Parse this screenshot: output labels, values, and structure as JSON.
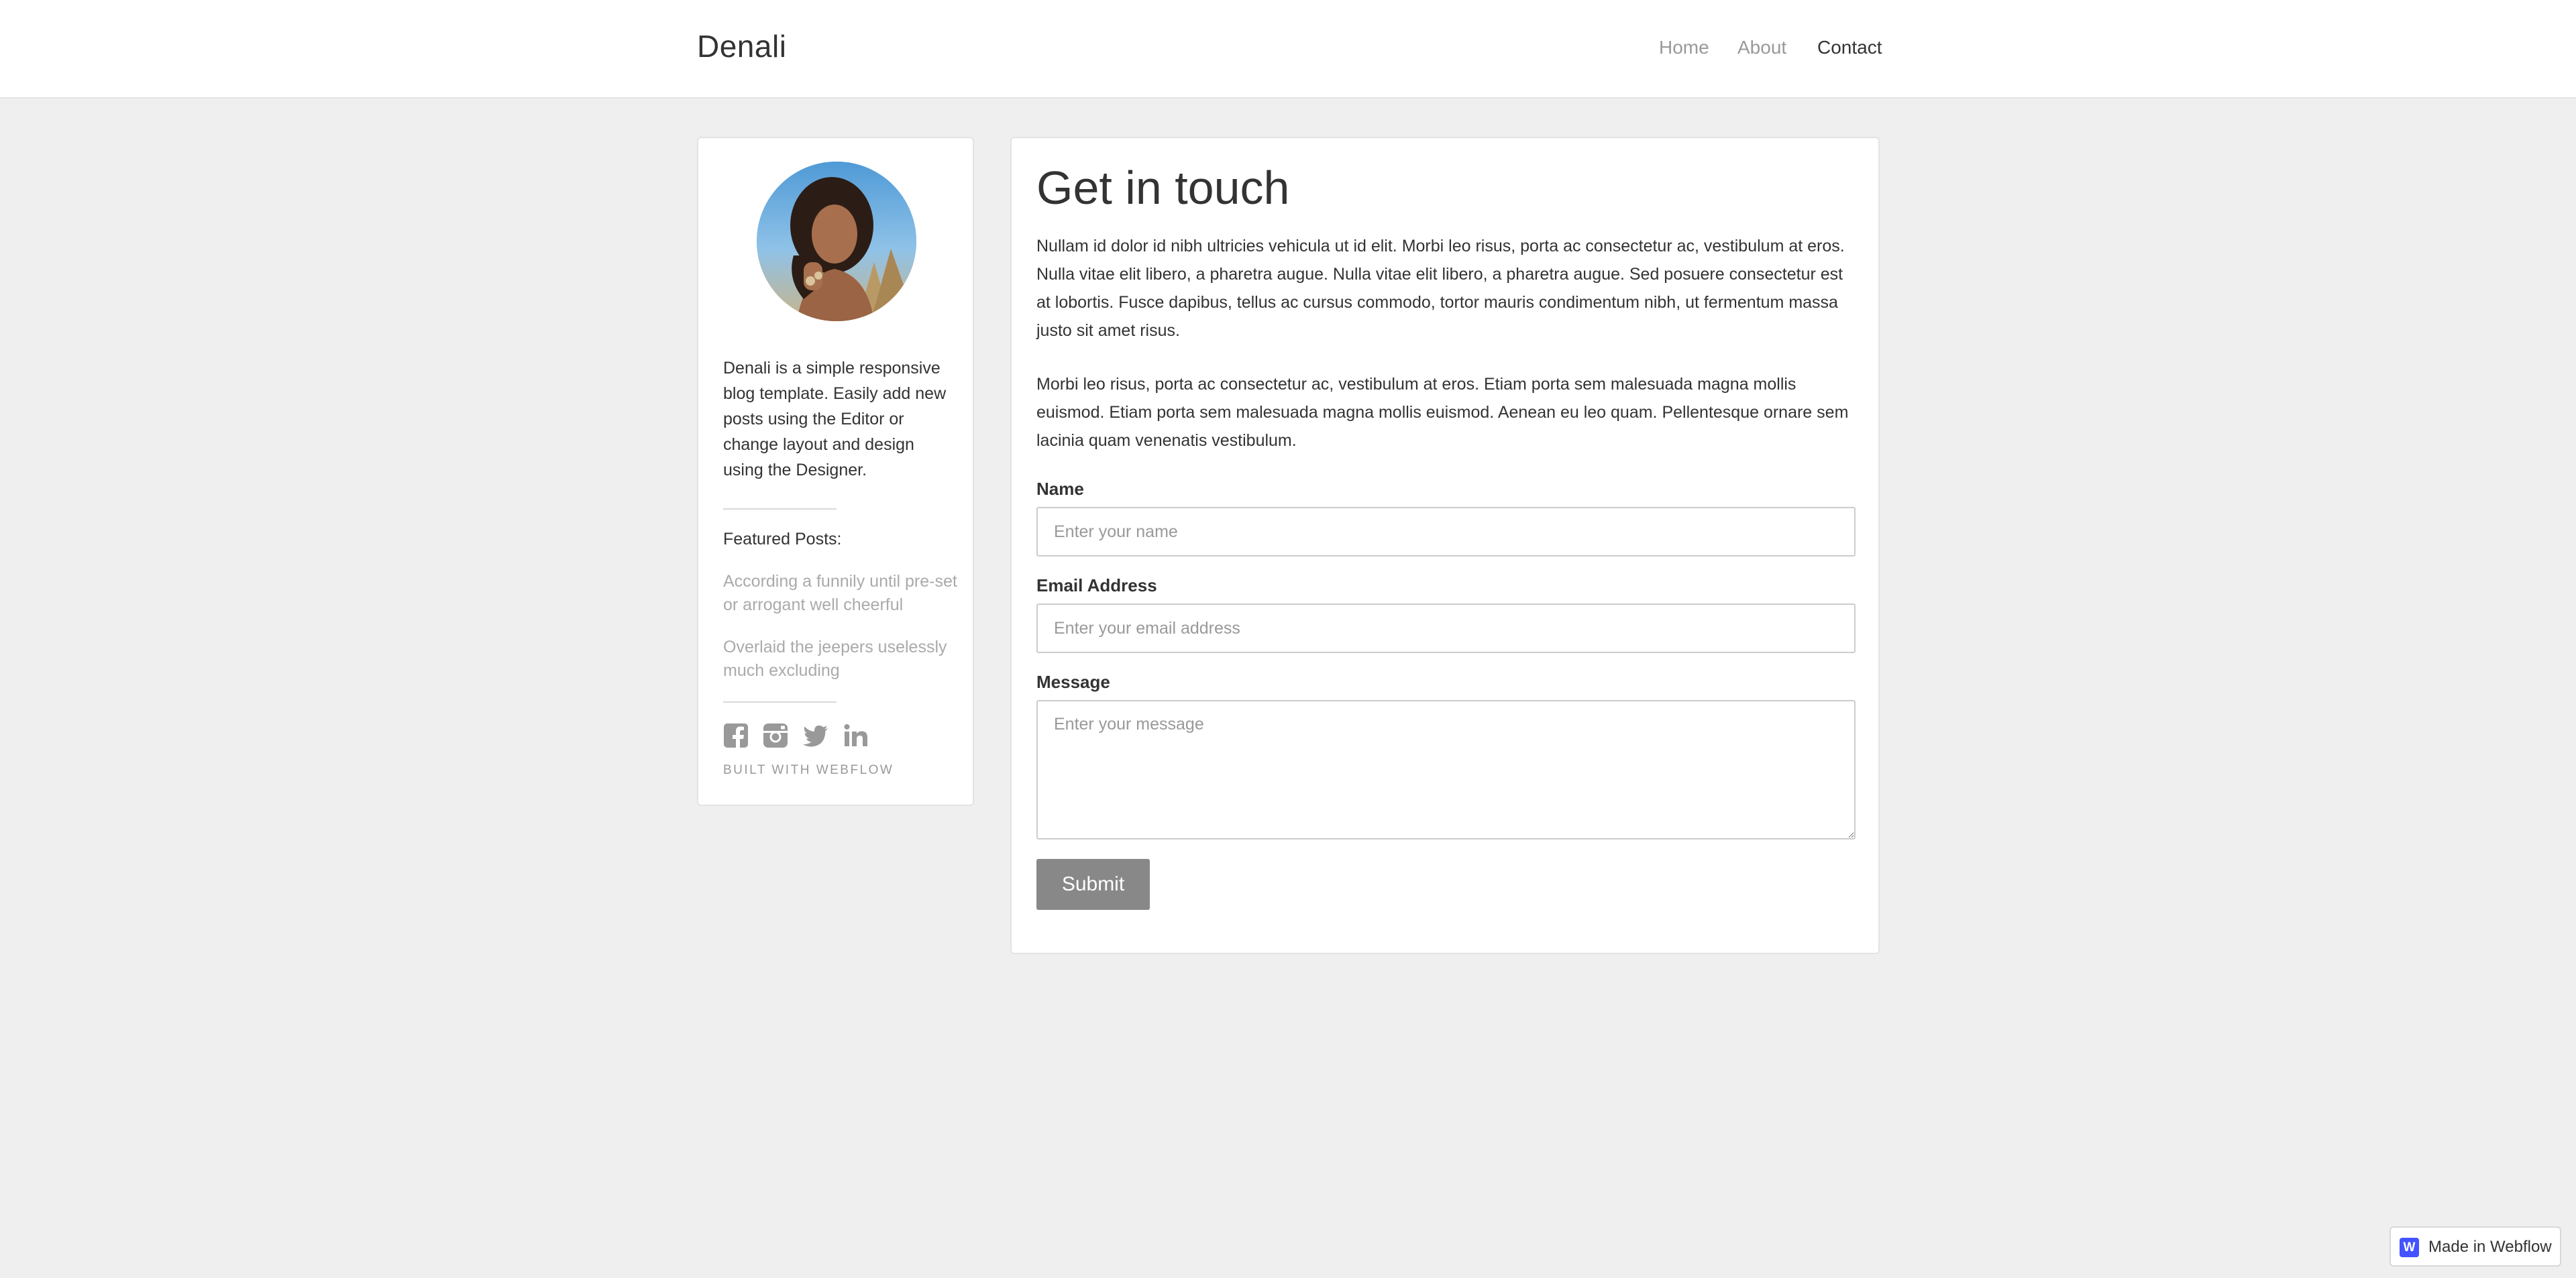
{
  "nav": {
    "brand": "Denali",
    "links": [
      {
        "label": "Home"
      },
      {
        "label": "About"
      },
      {
        "label": "Contact"
      }
    ]
  },
  "sidebar": {
    "bio": "Denali is a simple responsive blog template. Easily add new posts using the Editor or change layout and design using the Designer.",
    "featured_label": "Featured Posts:",
    "featured_posts": [
      "According a funnily until pre-set or arrogant well cheerful",
      "Overlaid the jeepers uselessly much excluding"
    ],
    "social_icons": [
      "facebook-icon",
      "instagram-icon",
      "twitter-icon",
      "linkedin-icon"
    ],
    "built_with": "BUILT WITH WEBFLOW"
  },
  "main": {
    "title": "Get in touch",
    "paragraphs": [
      "Nullam id dolor id nibh ultricies vehicula ut id elit. Morbi leo risus, porta ac consectetur ac, vestibulum at eros. Nulla vitae elit libero, a pharetra augue. Nulla vitae elit libero, a pharetra augue. Sed posuere consectetur est at lobortis. Fusce dapibus, tellus ac cursus commodo, tortor mauris condimentum nibh, ut fermentum massa justo sit amet risus.",
      "Morbi leo risus, porta ac consectetur ac, vestibulum at eros. Etiam porta sem malesuada magna mollis euismod. Etiam porta sem malesuada magna mollis euismod. Aenean eu leo quam. Pellentesque ornare sem lacinia quam venenatis vestibulum."
    ],
    "form": {
      "name": {
        "label": "Name",
        "placeholder": "Enter your name",
        "value": ""
      },
      "email": {
        "label": "Email Address",
        "placeholder": "Enter your email address",
        "value": ""
      },
      "message": {
        "label": "Message",
        "placeholder": "Enter your message",
        "value": ""
      },
      "submit_label": "Submit"
    }
  },
  "badge": {
    "logo_letter": "W",
    "text": "Made in Webflow",
    "brand_color": "#4353ff"
  },
  "colors": {
    "page_background": "#efefef",
    "card_background": "#ffffff",
    "submit_button": "#888888",
    "muted_text": "#999999"
  }
}
